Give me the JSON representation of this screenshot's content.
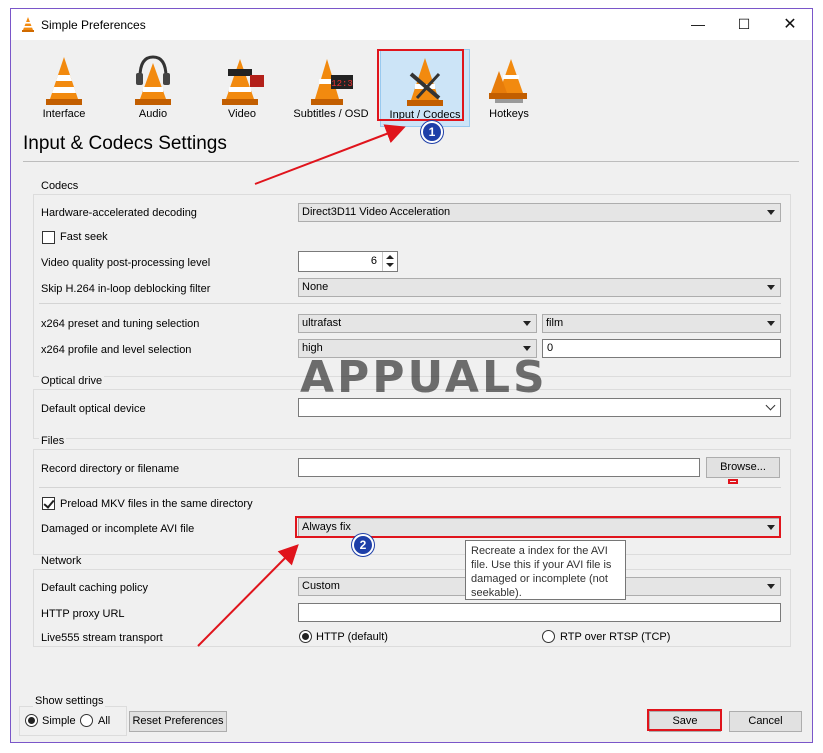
{
  "window": {
    "title": "Simple Preferences",
    "controls": {
      "minimize": "—",
      "maximize": "☐",
      "close": "✕"
    }
  },
  "categories": [
    {
      "label": "Interface",
      "icon": "interface-cone-icon"
    },
    {
      "label": "Audio",
      "icon": "audio-cone-headphones-icon"
    },
    {
      "label": "Video",
      "icon": "video-cone-glasses-icon"
    },
    {
      "label": "Subtitles / OSD",
      "icon": "subtitles-cone-clock-icon"
    },
    {
      "label": "Input / Codecs",
      "icon": "input-codecs-cone-icon",
      "selected": true
    },
    {
      "label": "Hotkeys",
      "icon": "hotkeys-cones-icon"
    }
  ],
  "page_heading": "Input & Codecs Settings",
  "codecs": {
    "group_label": "Codecs",
    "hw_decoding_label": "Hardware-accelerated decoding",
    "hw_decoding_value": "Direct3D11 Video Acceleration",
    "fast_seek_label": "Fast seek",
    "fast_seek_checked": false,
    "pp_level_label": "Video quality post-processing level",
    "pp_level_value": "6",
    "skip_h264_label": "Skip H.264 in-loop deblocking filter",
    "skip_h264_value": "None",
    "x264_preset_label": "x264 preset and tuning selection",
    "x264_preset_value": "ultrafast",
    "x264_tune_value": "film",
    "x264_profile_label": "x264 profile and level selection",
    "x264_profile_value": "high",
    "x264_level_value": "0"
  },
  "optical": {
    "group_label": "Optical drive",
    "device_label": "Default optical device",
    "device_value": ""
  },
  "files": {
    "group_label": "Files",
    "record_label": "Record directory or filename",
    "record_value": "",
    "browse_label": "Browse...",
    "preload_mkv_label": "Preload MKV files in the same directory",
    "preload_mkv_checked": true,
    "avi_label": "Damaged or incomplete AVI file",
    "avi_value": "Always fix",
    "avi_tooltip": "Recreate a index for the AVI file. Use this if your AVI file is damaged or incomplete (not seekable)."
  },
  "network": {
    "group_label": "Network",
    "caching_label": "Default caching policy",
    "caching_value": "Custom",
    "proxy_label": "HTTP proxy URL",
    "proxy_value": "",
    "live555_label": "Live555 stream transport",
    "http_option": "HTTP (default)",
    "rtsp_option": "RTP over RTSP (TCP)",
    "selected_transport": "HTTP (default)"
  },
  "footer": {
    "show_settings_label": "Show settings",
    "simple_label": "Simple",
    "all_label": "All",
    "show_settings_selected": "Simple",
    "reset_label": "Reset Preferences",
    "save_label": "Save",
    "cancel_label": "Cancel"
  },
  "annotations": {
    "badge_1": "1",
    "badge_2": "2",
    "watermark": "APPUALS",
    "highlight_color": "#e0141c",
    "badge_color": "#1e3fa8"
  },
  "colors": {
    "window_border": "#7a56c9",
    "dialog_bg": "#f0f0f0",
    "selected_tab_bg": "#cce4f7",
    "cone_orange": "#f28a0f"
  }
}
